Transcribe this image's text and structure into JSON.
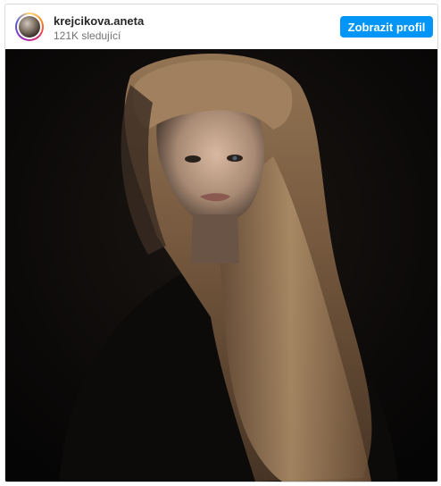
{
  "header": {
    "username": "krejcikova.aneta",
    "followers": "121K sledující",
    "profile_button": "Zobrazit profil"
  },
  "post": {
    "image_icon": "portrait-photo"
  },
  "colors": {
    "accent": "#0095f6",
    "username": "#262626",
    "secondary_text": "#737373",
    "photo_background": "#0b0908"
  }
}
